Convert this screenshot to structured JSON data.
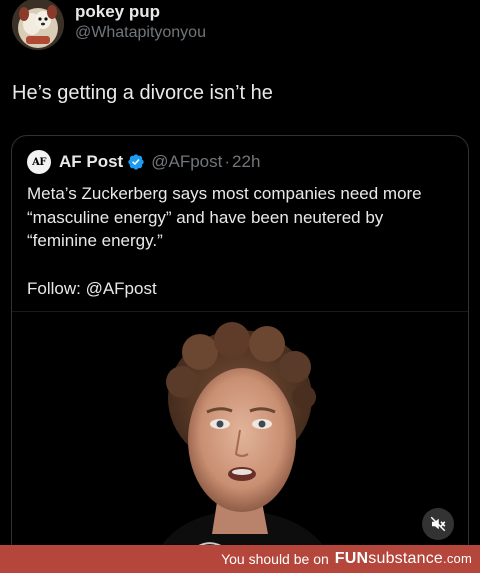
{
  "post": {
    "display_name": "pokey pup",
    "handle": "@Whatapityonyou",
    "text": "He’s getting a divorce isn’t he"
  },
  "quote": {
    "logo_text": "AF",
    "name": "AF Post",
    "verified_icon": "verified-badge-icon",
    "handle": "@AFpost",
    "separator": "·",
    "time": "22h",
    "body": "Meta’s Zuckerberg says most companies need more “masculine energy” and have been neutered by “feminine energy.”",
    "follow": "Follow: @AFpost"
  },
  "media": {
    "mute_icon": "mute-icon"
  },
  "footer": {
    "text": "You should be on",
    "brand_bold": "FUN",
    "brand_sub": "substance",
    "brand_tld": ".com"
  },
  "colors": {
    "background": "#000000",
    "text_primary": "#e7e9ea",
    "text_secondary": "#71767b",
    "border": "#2f3336",
    "verified": "#1d9bf0",
    "footer_bg": "#b5463c"
  }
}
